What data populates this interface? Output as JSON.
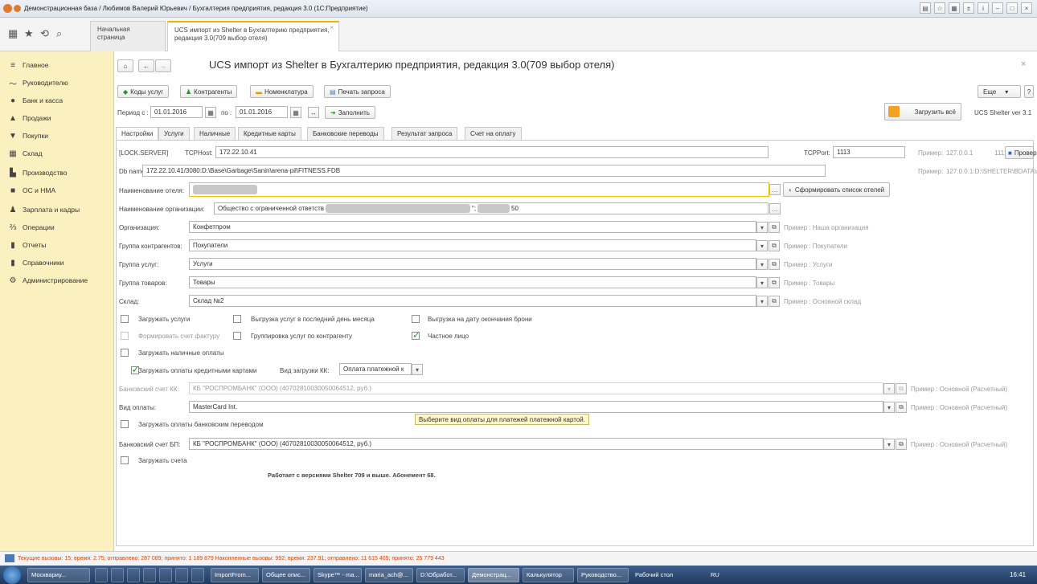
{
  "window": {
    "title": "Демонстрационная база / Любимов Валерий Юрьевич / Бухгалтерия предприятия, редакция 3.0  (1С:Предприятие)"
  },
  "top_tabs": [
    {
      "label": "Начальная страница"
    },
    {
      "label": "UCS импорт из Shelter в Бухгалтерию предприятия, редакция 3.0(709 выбор отеля)"
    }
  ],
  "sidebar": {
    "items": [
      {
        "label": "Главное",
        "icon": "menu-icon"
      },
      {
        "label": "Руководителю",
        "icon": "chart-line-icon"
      },
      {
        "label": "Банк и касса",
        "icon": "bank-icon"
      },
      {
        "label": "Продажи",
        "icon": "bag-icon"
      },
      {
        "label": "Покупки",
        "icon": "cart-icon"
      },
      {
        "label": "Склад",
        "icon": "warehouse-icon"
      },
      {
        "label": "Производство",
        "icon": "factory-icon"
      },
      {
        "label": "ОС и НМА",
        "icon": "truck-icon"
      },
      {
        "label": "Зарплата и кадры",
        "icon": "person-icon"
      },
      {
        "label": "Операции",
        "icon": "operations-icon"
      },
      {
        "label": "Отчеты",
        "icon": "reports-icon"
      },
      {
        "label": "Справочники",
        "icon": "book-icon"
      },
      {
        "label": "Администрирование",
        "icon": "gear-icon"
      }
    ]
  },
  "form": {
    "title": "UCS импорт из Shelter в Бухгалтерию предприятия, редакция 3.0(709 выбор отеля)",
    "toolbar": {
      "services": "Коды услуг",
      "contractors": "Контрагенты",
      "nomenclature": "Номенклатура",
      "print": "Печать запроса",
      "more": "Еще",
      "help": "?"
    },
    "period": {
      "label_from": "Период с :",
      "from": "01.01.2016",
      "label_to": "по :",
      "to": "01.01.2016",
      "fill": "Заполнить"
    },
    "load_all": "Загрузить всё",
    "version": "UCS Shelter  ver 3.1",
    "tabs": [
      "Настройки",
      "Услуги",
      "Наличные",
      "Кредитные карты",
      "Банковские переводы",
      "Результат запроса",
      "Счет на оплату"
    ],
    "settings": {
      "lock_server": "[LOCK.SERVER]",
      "tcphost_label": "TCPHost:",
      "tcphost": "172.22.10.41",
      "tcpport_label": "TCPPort:",
      "tcpport": "1113",
      "example_label": "Пример:",
      "example_host": "127.0.0.1",
      "example_port": "1111",
      "check": "Проверить",
      "db_label": "Db name:",
      "db": "172.22.10.41/3080:D:\\Base\\Garbage\\Sanin\\arena-pil\\FITNESS.FDB",
      "db_example": "127.0.0.1:D:\\SHELTER\\BDATA\\shelter.fdb",
      "hotel_label": "Наименование отеля:",
      "make_list": "Сформировать список отелей",
      "org_name_label": "Наименование организации:",
      "org_name_a": "Общество с ограниченной ответств",
      "org_name_b": "\";",
      "org_name_c": "50",
      "rows": [
        {
          "label": "Организация:",
          "value": "Конфетпром",
          "hint": "Пример : Наша организация"
        },
        {
          "label": "Группа контрагентов:",
          "value": "Покупатели",
          "hint": "Пример : Покупатели"
        },
        {
          "label": "Группа услуг:",
          "value": "Услуги",
          "hint": "Пример : Услуги"
        },
        {
          "label": "Группа товаров:",
          "value": "Товары",
          "hint": "Пример : Товары"
        },
        {
          "label": "Склад:",
          "value": "Склад №2",
          "hint": "Пример : Основной склад"
        }
      ],
      "cb_load_services": "Загружать услуги",
      "cb_last_day": "Выгрузка услуг в последний день месяца",
      "cb_end_date": "Выгрузка на дату окончания брони",
      "cb_invoice": "Формировать счет фактуру",
      "cb_group": "Группировка услуг по контрагенту",
      "cb_private": "Частное лицо",
      "cb_cash": "Загружать наличные оплаты",
      "cb_cards": "Загружать оплаты кредитными картами",
      "kk_label": "Вид загрузки КК:",
      "kk_value": "Оплата платежной к",
      "bank_kk_label": "Банковский счет КК:",
      "bank_value": "КБ \"РОСПРОМБАНК\" (ООО) (40702810030050064512, руб.)",
      "bank_hint": "Пример : Основной (Расчетный)",
      "payment_label": "Вид оплаты:",
      "payment_value": "MasterCard Int.",
      "tooltip": "Выберите вид оплаты для платежей платежной картой.",
      "cb_transfers": "Загружать оплаты банковским переводом",
      "bank_bp_label": "Банковский счет БП:",
      "cb_bills": "Загружать счета",
      "note": "Работает с версиями Shelter 709 и выше. Абонемент 68."
    }
  },
  "status": {
    "text": "Текущие вызовы: 15; время: 2.75; отправлено: 287 089; принято: 1 189 879   Накопленные вызовы: 992; время: 237.91; отправлено: 11 615 405; принято: 25 779 443"
  },
  "taskbar": {
    "items": [
      "Москвариу...",
      "ImportFrom...",
      "Общее опис...",
      "Skype™ - ma...",
      "maria_ach@...",
      "D:\\Обработ...",
      "Демонстрац...",
      "Калькулятор",
      "Руководство..."
    ],
    "desktop": "Рабочий стол",
    "lang": "RU",
    "clock": "16:41"
  },
  "colors": {
    "sidebar": "#fbf0c0",
    "accent": "#f0b400",
    "tooltip": "#fff8c8",
    "taskbar": "#2c4a75"
  }
}
